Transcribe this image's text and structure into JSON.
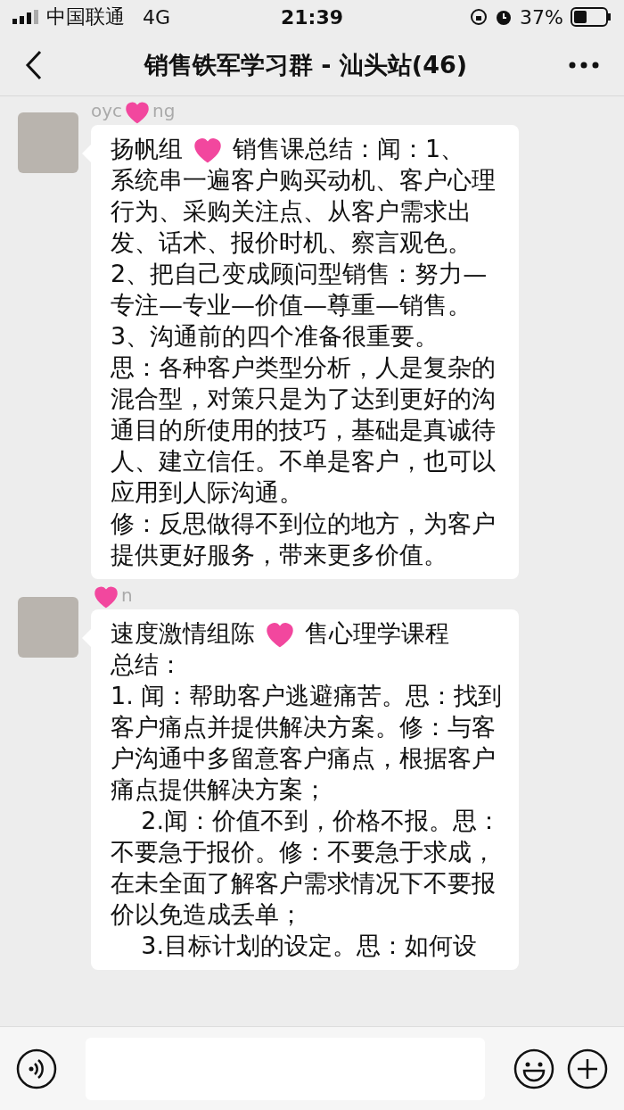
{
  "status_bar": {
    "carrier": "中国联通",
    "network": "4G",
    "time": "21:39",
    "battery": "37%"
  },
  "nav": {
    "title": "销售铁军学习群 - 汕头站(46)"
  },
  "messages": [
    {
      "sender": [
        {
          "kind": "text",
          "text": "oyc"
        },
        {
          "kind": "covered"
        },
        {
          "kind": "text",
          "text": "ng"
        }
      ],
      "paragraphs": [
        [
          {
            "kind": "text",
            "text": "扬帆组"
          },
          {
            "kind": "covered"
          },
          {
            "kind": "text",
            "text": "销售课总结：闻：1、"
          }
        ],
        [
          {
            "kind": "text",
            "text": "系统串一遍客户购买动机、客户心理行为、采购关注点、从客户需求出发、话术、报价时机、察言观色。2、把自己变成顾问型销售：努力—专注—专业—价值—尊重—销售。3、沟通前的四个准备很重要。"
          }
        ],
        [
          {
            "kind": "text",
            "text": "思：各种客户类型分析，人是复杂的混合型，对策只是为了达到更好的沟通目的所使用的技巧，基础是真诚待人、建立信任。不单是客户，也可以应用到人际沟通。"
          }
        ],
        [
          {
            "kind": "text",
            "text": "修：反思做得不到位的地方，为客户提供更好服务，带来更多价值。"
          }
        ]
      ]
    },
    {
      "sender": [
        {
          "kind": "covered"
        },
        {
          "kind": "text",
          "text": "n"
        }
      ],
      "paragraphs": [
        [
          {
            "kind": "text",
            "text": "速度激情组陈"
          },
          {
            "kind": "covered"
          },
          {
            "kind": "text",
            "text": "售心理学课程"
          }
        ],
        [
          {
            "kind": "text",
            "text": "总结："
          }
        ],
        [
          {
            "kind": "text",
            "text": "1. 闻：帮助客户逃避痛苦。思：找到客户痛点并提供解决方案。修：与客户沟通中多留意客户痛点，根据客户痛点提供解决方案；"
          }
        ],
        [
          {
            "kind": "text",
            "text": "    2.闻：价值不到，价格不报。思：不要急于报价。修：不要急于求成，在未全面了解客户需求情况下不要报价以免造成丢单；"
          }
        ],
        [
          {
            "kind": "text",
            "text": "    3.目标计划的设定。思：如何设"
          }
        ]
      ]
    }
  ]
}
